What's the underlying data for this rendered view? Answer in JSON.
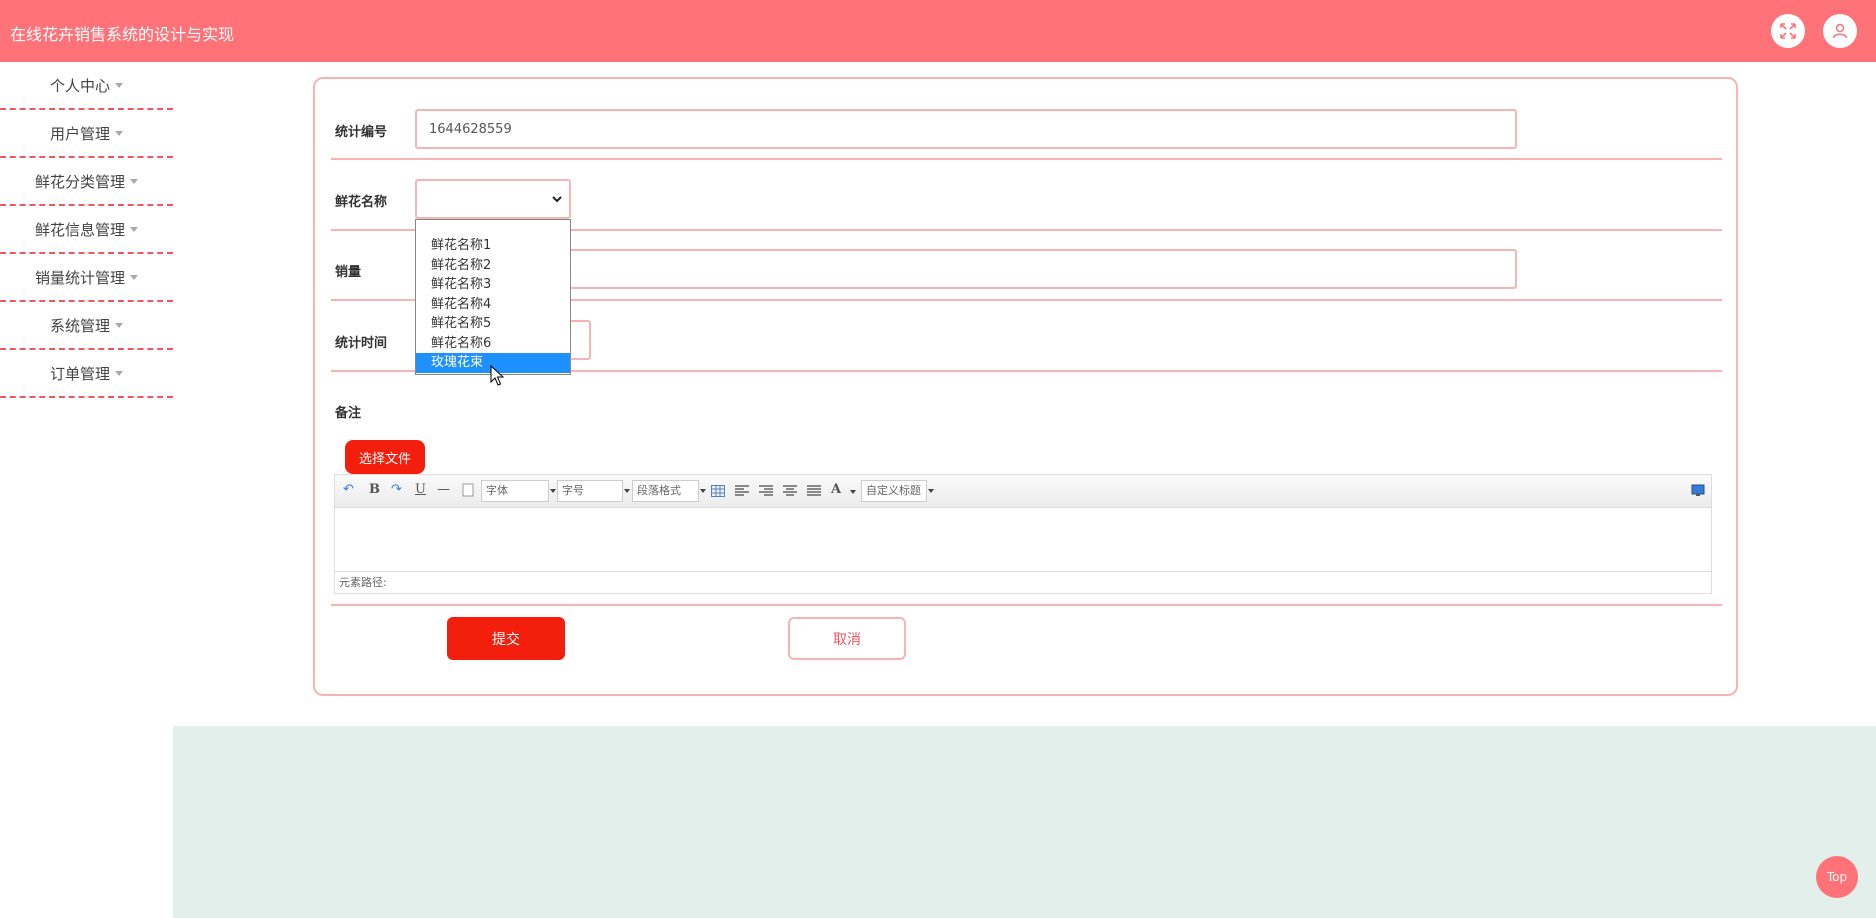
{
  "header": {
    "title": "在线花卉销售系统的设计与实现"
  },
  "icons": {
    "fullscreen": "fullscreen-icon",
    "user": "user-icon",
    "caret": "caret-down-icon"
  },
  "colors": {
    "brand": "#ff7378",
    "primary_button": "#f41e0c",
    "border": "#f8b4b4",
    "dashed": "#f0565c",
    "footer_bg": "#e3efeb",
    "selected_option": "#1e90ff"
  },
  "sidebar": {
    "items": [
      {
        "label": "个人中心"
      },
      {
        "label": "用户管理"
      },
      {
        "label": "鲜花分类管理"
      },
      {
        "label": "鲜花信息管理"
      },
      {
        "label": "销量统计管理"
      },
      {
        "label": "系统管理"
      },
      {
        "label": "订单管理"
      }
    ]
  },
  "form": {
    "stat_id": {
      "label": "统计编号",
      "value": "1644628559"
    },
    "flower_name": {
      "label": "鲜花名称",
      "value": "",
      "options": [
        "鲜花名称1",
        "鲜花名称2",
        "鲜花名称3",
        "鲜花名称4",
        "鲜花名称5",
        "鲜花名称6",
        "玫瑰花束"
      ],
      "highlighted": "玫瑰花束"
    },
    "sales": {
      "label": "销量",
      "value": ""
    },
    "stat_time": {
      "label": "统计时间",
      "value": ""
    },
    "remark": {
      "label": "备注"
    },
    "file_button": "选择文件",
    "editor": {
      "toolbar": {
        "undo": "↶",
        "bold": "B",
        "redo": "↷",
        "underline": "U",
        "hr": "—",
        "font_family": "字体",
        "font_size": "字号",
        "paragraph": "段落格式",
        "font_color": "A",
        "custom_title": "自定义标题"
      },
      "path_label": "元素路径:"
    },
    "submit": "提交",
    "cancel": "取消"
  },
  "top_button": "Top"
}
